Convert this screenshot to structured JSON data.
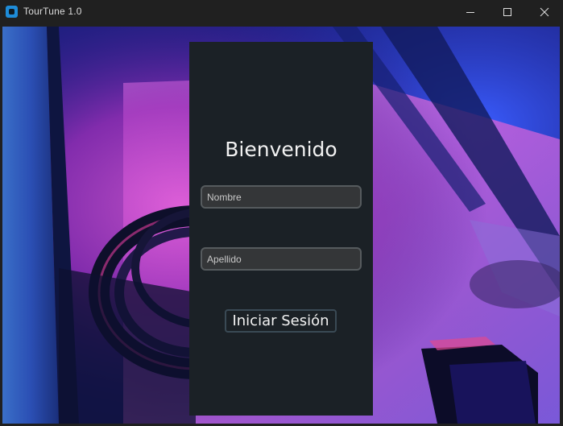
{
  "window": {
    "title": "TourTune 1.0",
    "controls": [
      "minimize-icon",
      "maximize-icon",
      "close-icon"
    ]
  },
  "login": {
    "heading": "Bienvenido",
    "first_name_placeholder": "Nombre",
    "first_name_value": "",
    "last_name_placeholder": "Apellido",
    "last_name_value": "",
    "submit_label": "Iniciar Sesión"
  },
  "colors": {
    "panel": "#1b2126",
    "field_bg": "#343638",
    "field_border": "#565b5e",
    "accent_icon": "#1e8cd8"
  }
}
